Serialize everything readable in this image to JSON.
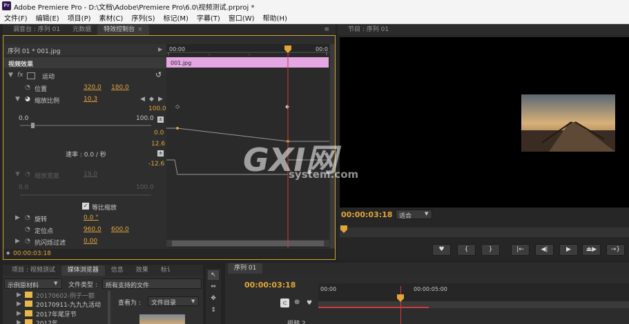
{
  "app": {
    "logo_text": "Pr",
    "title": "Adobe Premiere Pro - D:\\文档\\Adobe\\Premiere Pro\\6.0\\视频测试.prproj *"
  },
  "menu": [
    "文件(F)",
    "编辑(E)",
    "项目(P)",
    "素材(C)",
    "序列(S)",
    "标记(M)",
    "字幕(T)",
    "窗口(W)",
    "帮助(H)"
  ],
  "effect_panel": {
    "tabs": [
      {
        "label": "调音台 : 序列 01"
      },
      {
        "label": "元数据"
      },
      {
        "label": "特效控制台",
        "close": "×"
      }
    ],
    "menu_icon": "≡",
    "sequence_label": "序列 01 * 001.jpg",
    "play_icon": "▶",
    "ruler_start": "00:00",
    "ruler_end": "00:0",
    "clip_label": "001.jpg",
    "video_effects": "视频效果",
    "motion": "运动",
    "fx": "fx",
    "reset_icon": "↺",
    "position": {
      "label": "位置",
      "x": "320.0",
      "y": "180.0"
    },
    "scale": {
      "label": "缩放比例",
      "value": "10.3",
      "graph_max": "100.0",
      "graph_min": "0.0",
      "slider_min": "0.0",
      "slider_max": "100.0"
    },
    "velocity": {
      "label": "速率 : 0.0 / 秒",
      "max": "12.6",
      "zero": "0.0",
      "min": "-12.6"
    },
    "scale_width": {
      "label": "缩放宽度",
      "value": "19.0",
      "slider_min": "0.0",
      "slider_max": "100.0"
    },
    "uniform_scale": {
      "label": "等比缩放",
      "checked": true,
      "check_mark": "✓"
    },
    "rotation": {
      "label": "旋转",
      "value": "0.0 °"
    },
    "anchor": {
      "label": "定位点",
      "x": "960.0",
      "y": "600.0"
    },
    "antiflicker": {
      "label": "抗闪烁过滤",
      "value": "0.00"
    },
    "timecode": "00:00:03:18"
  },
  "program_panel": {
    "tab": "节目 : 序列 01",
    "timecode": "00:00:03:18",
    "fit_label": "适合",
    "buttons": [
      "♥",
      "{",
      "}",
      "|←",
      "◀|",
      "▶",
      "⏏▶",
      "→}"
    ]
  },
  "project_panel": {
    "tabs": [
      "项目 : 视频测试",
      "媒体浏览器",
      "信息",
      "效果",
      "标讠"
    ],
    "media_source": "示例原材料",
    "file_type_label": "文件类型 :",
    "file_type_value": "所有支持的文件",
    "view_as_label": "查看为 :",
    "view_as_value": "文件目录",
    "folders": [
      "20170602-例子一额",
      "20170911-九九九活动",
      "2017年尾牙节",
      "2017年..."
    ]
  },
  "timeline_panel": {
    "tab": "序列 01",
    "timecode": "00:00:03:18",
    "ruler_start": "00:00",
    "ruler_mid": "00:00:05:00",
    "track_label": "视频 2"
  },
  "watermark": {
    "logo": "GXI网",
    "sub": "system.com"
  },
  "colors": {
    "accent_orange": "#e3a53a",
    "clip_pink": "#e4a7e4",
    "playhead_red": "#d13a3a",
    "panel_focus": "#d4a32d"
  }
}
